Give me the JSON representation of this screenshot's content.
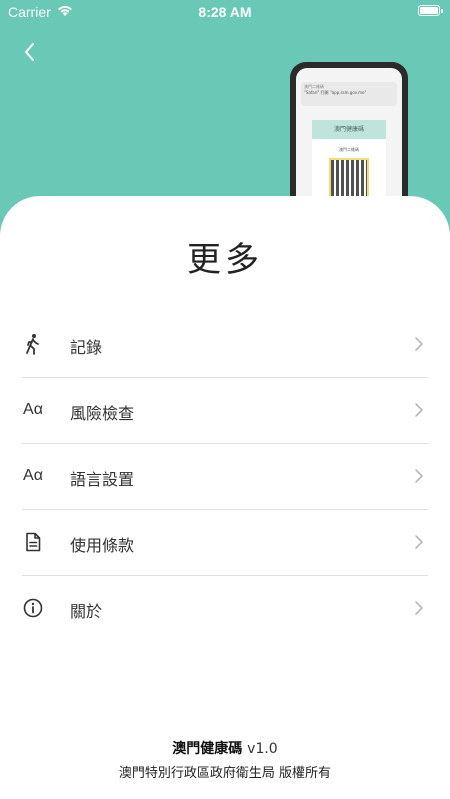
{
  "status_bar": {
    "carrier": "Carrier",
    "time": "8:28 AM"
  },
  "colors": {
    "header_teal": "#69c8b6",
    "text_primary": "#222222",
    "divider": "#e0e0e0"
  },
  "phone_mockup": {
    "notification_title": "澳門二維碼",
    "notification_text": "\"Safari\" 打開 \"app.ssm.gov.mo\"",
    "card_title": "澳門健康碼",
    "card_subtitle": "澳門二維碼"
  },
  "page": {
    "title": "更多"
  },
  "menu": {
    "items": [
      {
        "label": "記錄",
        "icon": "walking-person-icon",
        "icon_text": ""
      },
      {
        "label": "風險檢查",
        "icon": "text-size-icon",
        "icon_text": "Aα"
      },
      {
        "label": "語言設置",
        "icon": "text-size-icon",
        "icon_text": "Aα"
      },
      {
        "label": "使用條款",
        "icon": "document-icon",
        "icon_text": ""
      },
      {
        "label": "關於",
        "icon": "info-circle-icon",
        "icon_text": ""
      }
    ]
  },
  "footer": {
    "app_name": "澳門健康碼",
    "version": "v1.0",
    "organization": "澳門特別行政區政府衛生局 版權所有"
  }
}
